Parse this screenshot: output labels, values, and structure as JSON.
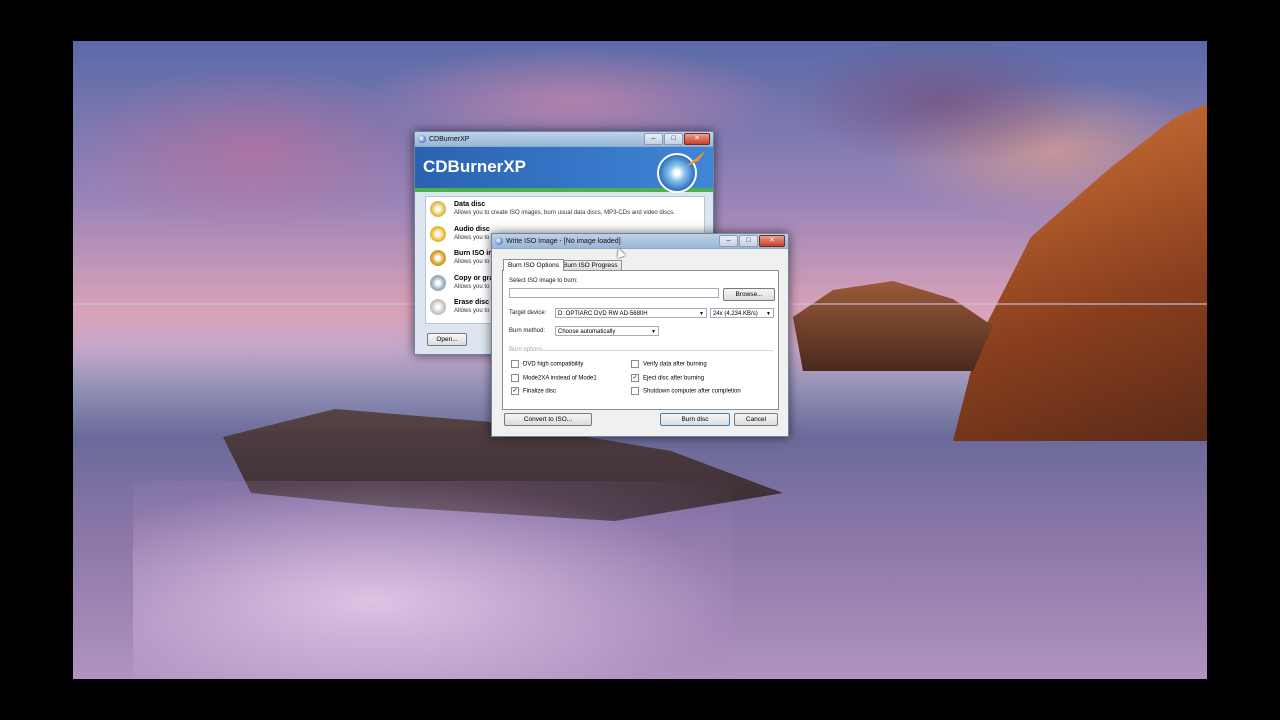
{
  "main_window": {
    "title": "CDBurnerXP",
    "banner_title": "CDBurnerXP",
    "items": [
      {
        "name": "Data disc",
        "desc": "Allows you to create ISO images, burn usual data discs, MP3-CDs and video discs."
      },
      {
        "name": "Audio disc",
        "desc": "Allows you to"
      },
      {
        "name": "Burn ISO in",
        "desc": "Allows you to"
      },
      {
        "name": "Copy or gra",
        "desc": "Allows you to"
      },
      {
        "name": "Erase disc",
        "desc": "Allows you to"
      }
    ],
    "open_button": "Open..."
  },
  "dialog": {
    "title": "Write ISO Image - [No image loaded]",
    "tabs": [
      "Burn ISO Options",
      "Burn ISO Progress"
    ],
    "select_label": "Select ISO image to burn:",
    "iso_path": "",
    "browse_button": "Browse...",
    "target_label": "Target device:",
    "target_device": "D: OPTIARC DVD RW AD-5680H",
    "speed": "24x (4,234 KB/s)",
    "method_label": "Burn method:",
    "method": "Choose automatically",
    "options_label": "Burn options",
    "options_left": [
      {
        "label": "DVD high compatibility",
        "checked": false
      },
      {
        "label": "Mode2XA instead of Mode1",
        "checked": false
      },
      {
        "label": "Finalize disc",
        "checked": true
      }
    ],
    "options_right": [
      {
        "label": "Verify data after burning",
        "checked": false
      },
      {
        "label": "Eject disc after burning",
        "checked": true
      },
      {
        "label": "Shutdown computer after completion",
        "checked": false
      }
    ],
    "convert_button": "Convert to ISO...",
    "burn_button": "Burn disc",
    "cancel_button": "Cancel"
  },
  "colors": {
    "banner": "#2f6db5",
    "banner_stripe": "#4caf50",
    "accent": "#3a7bd5"
  }
}
